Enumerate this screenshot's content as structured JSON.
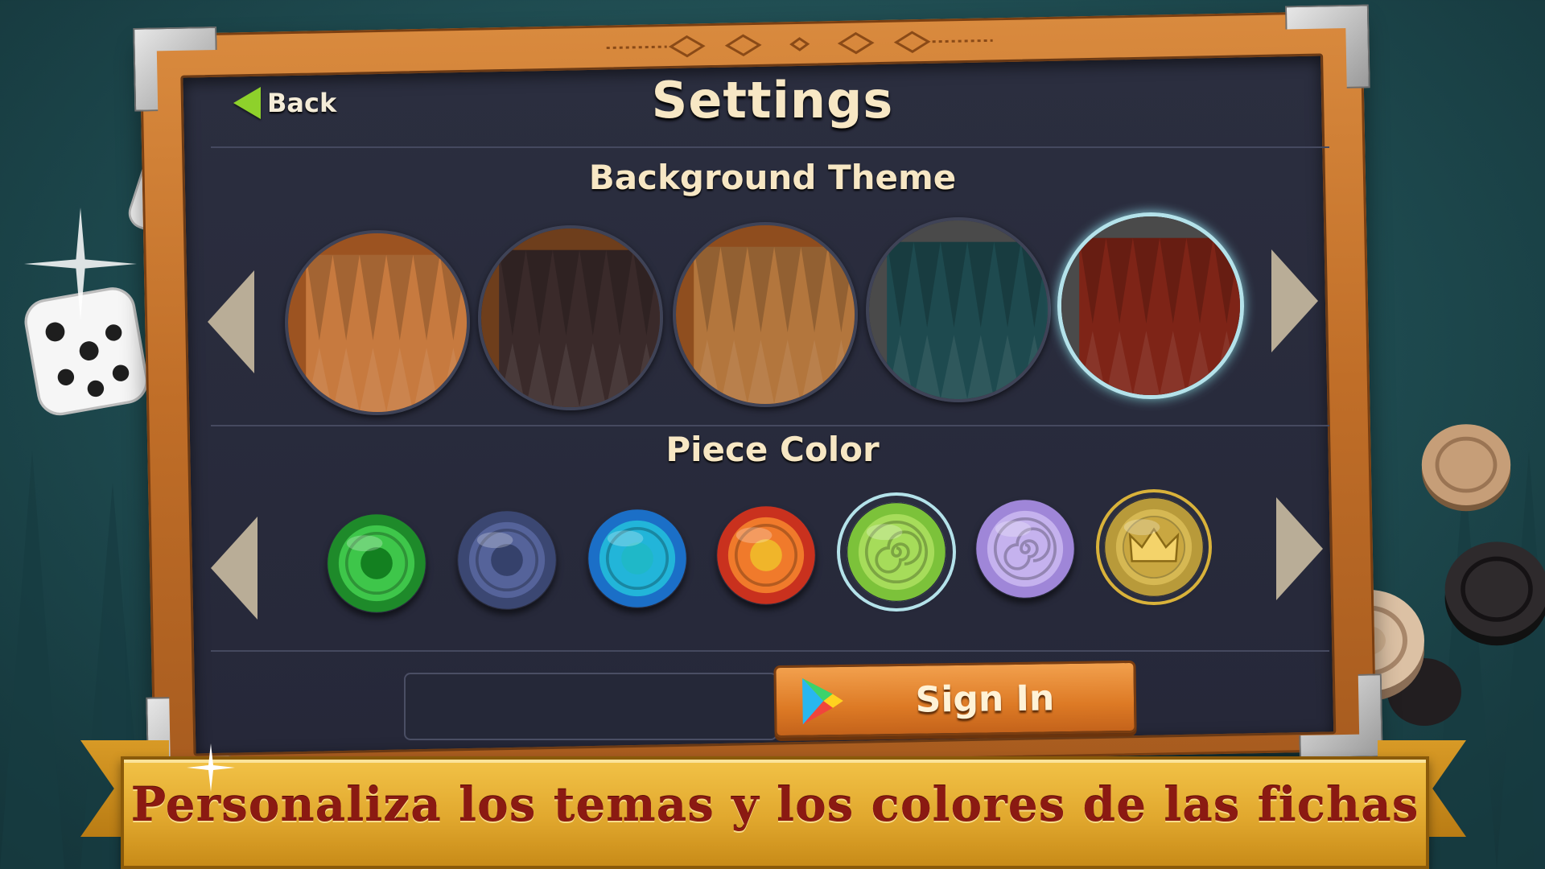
{
  "header": {
    "back_label": "Back",
    "title": "Settings"
  },
  "sections": {
    "background_theme_title": "Background Theme",
    "piece_color_title": "Piece Color"
  },
  "themes": [
    {
      "name": "light wood",
      "selected": false,
      "board": "#c77a3f",
      "frame": "#9c5321"
    },
    {
      "name": "dark wood",
      "selected": false,
      "board": "#3a2a2a",
      "frame": "#6e3e1c"
    },
    {
      "name": "natural wood",
      "selected": false,
      "board": "#b3763d",
      "frame": "#8f4e1f"
    },
    {
      "name": "teal felt",
      "selected": false,
      "board": "#1e4a4f",
      "frame": "#4a4a4a"
    },
    {
      "name": "red felt",
      "selected": true,
      "board": "#7e2417",
      "frame": "#4a4a4a"
    }
  ],
  "pieces": [
    {
      "name": "green",
      "outer": "#1e8a2a",
      "inner": "#3ec64a",
      "center": "#138020",
      "selected": false
    },
    {
      "name": "navy",
      "outer": "#3b4772",
      "inner": "#55639a",
      "center": "#35416b",
      "selected": false
    },
    {
      "name": "blue",
      "outer": "#1b6fc7",
      "inner": "#22b5d9",
      "center": "#1fb8c8",
      "selected": false
    },
    {
      "name": "red-orange",
      "outer": "#c9311e",
      "inner": "#f07a2b",
      "center": "#f0b52a",
      "selected": false
    },
    {
      "name": "lime swirl",
      "outer": "#7cc23a",
      "inner": "#a6dc5a",
      "center": "#7cc23a",
      "selected": true
    },
    {
      "name": "lavender swirl",
      "outer": "#9f86d8",
      "inner": "#c5b2ee",
      "center": "#a18ad9",
      "selected": false
    },
    {
      "name": "gold crown",
      "outer": "#b89a3a",
      "inner": "#d6b853",
      "center": "#c9a741",
      "selected": false,
      "special": true
    }
  ],
  "signin": {
    "label": "Sign In",
    "icon": "google-play-icon"
  },
  "banner": {
    "text": "Personaliza los temas y los colores de las fichas"
  },
  "colors": {
    "accent_back": "#8ed12b",
    "selection_ring": "#b4e2ea",
    "banner_text": "#8b1a12",
    "button_orange": "#dd7a25"
  }
}
